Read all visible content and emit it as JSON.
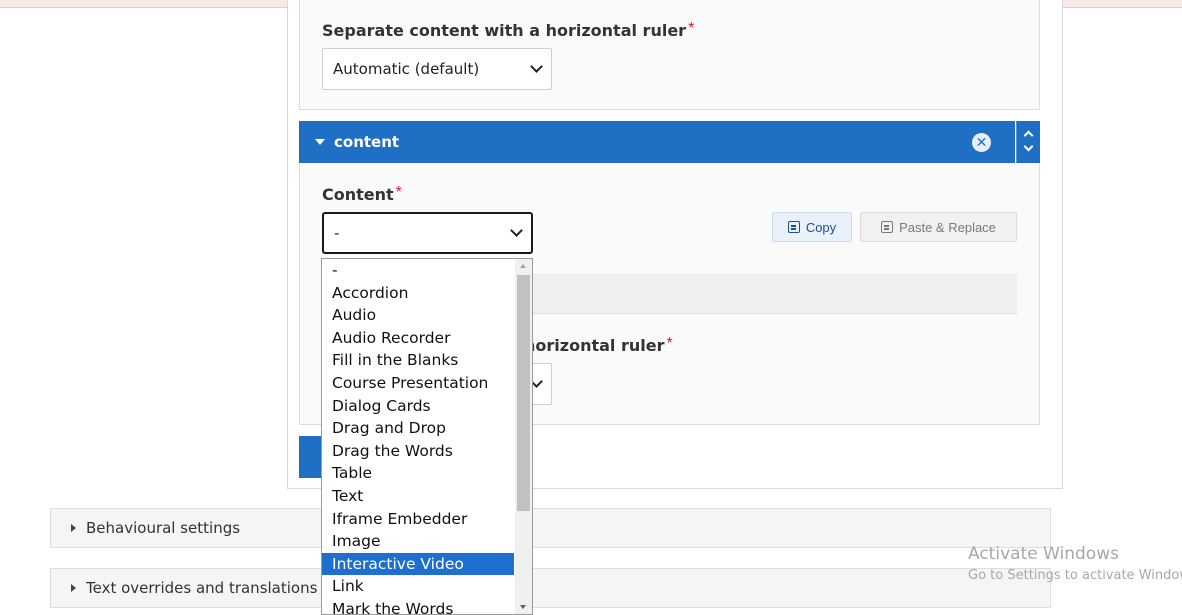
{
  "colors": {
    "accent": "#1f6fc4",
    "required": "#d9212c",
    "selected_option": "#1e6fcf"
  },
  "top_field": {
    "label": "Separate content with a horizontal ruler",
    "required_mark": "*",
    "select_value": "Automatic (default)"
  },
  "content_group": {
    "title": "content",
    "remove_icon": "close-circle-icon",
    "reorder_icon": "up-down-arrows-icon"
  },
  "content_field": {
    "label": "Content",
    "required_mark": "*",
    "select_value": "-"
  },
  "toolbar": {
    "copy_label": "Copy",
    "paste_label": "Paste & Replace"
  },
  "second_field": {
    "label_partial": "horizontal ruler",
    "required_mark": "*"
  },
  "dropdown": {
    "options": [
      "-",
      "Accordion",
      "Audio",
      "Audio Recorder",
      "Fill in the Blanks",
      "Course Presentation",
      "Dialog Cards",
      "Drag and Drop",
      "Drag the Words",
      "Table",
      "Text",
      "Iframe Embedder",
      "Image",
      "Interactive Video",
      "Link",
      "Mark the Words"
    ],
    "selected": "Interactive Video"
  },
  "sections": {
    "behavioural": "Behavioural settings",
    "text_overrides": "Text overrides and translations"
  },
  "watermark": {
    "line1": "Activate Windows",
    "line2": "Go to Settings to activate Windows."
  }
}
